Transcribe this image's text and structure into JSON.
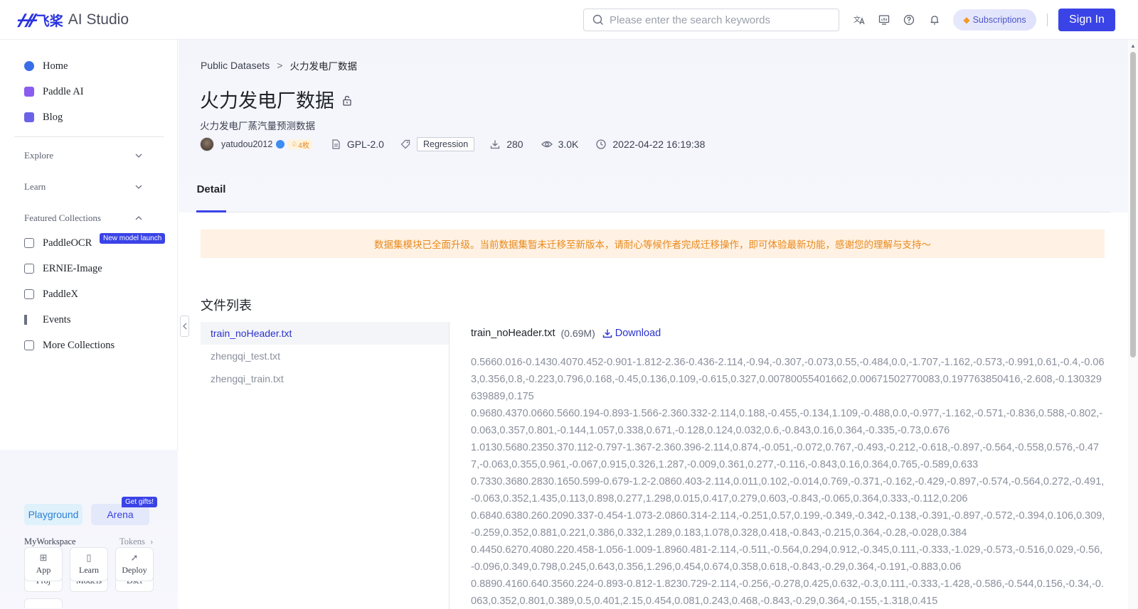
{
  "header": {
    "logo_mark": "ᚋᚌ",
    "logo_cn": "飞桨",
    "logo_text": "AI Studio",
    "search_placeholder": "Please enter the search keywords",
    "subscriptions_label": "Subscriptions",
    "signin_label": "Sign In",
    "icons": [
      "translate-icon",
      "monitor-icon",
      "help-icon",
      "bell-icon"
    ]
  },
  "sidebar": {
    "top_items": [
      {
        "label": "Home",
        "icon": "home-icon",
        "color": "#3a6ee8"
      },
      {
        "label": "Paddle AI",
        "icon": "paddle-ai-icon",
        "color": "#8a5cf0"
      },
      {
        "label": "Blog",
        "icon": "blog-icon",
        "color": "#6a63e8"
      }
    ],
    "sections": [
      {
        "label": "Explore",
        "chevron": "⌄"
      },
      {
        "label": "Learn",
        "chevron": "⌄"
      },
      {
        "label": "Featured Collections",
        "chevron": "⌃"
      }
    ],
    "collections": [
      {
        "label": "PaddleOCR",
        "icon": "ocr-icon"
      },
      {
        "label": "ERNIE-Image",
        "icon": "image-icon"
      },
      {
        "label": "PaddleX",
        "icon": "paddlex-icon"
      },
      {
        "label": "Events",
        "icon": "flag-icon"
      },
      {
        "label": "More Collections",
        "icon": "collections-icon"
      }
    ],
    "new_badge": "New model launch",
    "workspace": {
      "playground_label": "Playground",
      "arena_label": "Arena",
      "gift_badge": "Get gifts!",
      "title": "MyWorkspace",
      "tokens_label": "Tokens",
      "tiles": [
        {
          "label": "Proj",
          "icon": "folder-icon"
        },
        {
          "label": "Models",
          "icon": "cube-icon"
        },
        {
          "label": "Dset",
          "icon": "bar-chart-icon"
        },
        {
          "label": "App",
          "icon": "grid-icon"
        },
        {
          "label": "Learn",
          "icon": "book-icon"
        },
        {
          "label": "Deploy",
          "icon": "rocket-icon"
        }
      ]
    }
  },
  "dataset": {
    "breadcrumb_root": "Public Datasets",
    "breadcrumb_sep": ">",
    "breadcrumb_current": "火力发电厂数据",
    "title": "火力发电厂数据",
    "subtitle": "火力发电厂蒸汽量预测数据",
    "author": "yatudou2012",
    "author_level": "4枚",
    "license": "GPL-2.0",
    "tag": "Regression",
    "downloads": "280",
    "views": "3.0K",
    "date": "2022-04-22 16:19:38",
    "tab_detail": "Detail"
  },
  "notice": "数据集模块已全面升级。当前数据集暂未迁移至新版本，请耐心等候作者完成迁移操作，即可体验最新功能，感谢您的理解与支持～",
  "files": {
    "title": "文件列表",
    "items": [
      "train_noHeader.txt",
      "zhengqi_test.txt",
      "zhengqi_train.txt"
    ],
    "active_index": 0
  },
  "preview": {
    "filename": "train_noHeader.txt",
    "size": "(0.69M)",
    "download_label": "Download",
    "rows": [
      "0.5660.016-0.1430.4070.452-0.901-1.812-2.36-0.436-2.114,-0.94,-0.307,-0.073,0.55,-0.484,0.0,-1.707,-1.162,-0.573,-0.991,0.61,-0.4,-0.063,0.356,0.8,-0.223,0.796,0.168,-0.45,0.136,0.109,-0.615,0.327,0.00780055401662,0.00671502770083,0.197763850416,-2.608,-0.130329639889,0.175",
      "0.9680.4370.0660.5660.194-0.893-1.566-2.360.332-2.114,0.188,-0.455,-0.134,1.109,-0.488,0.0,-0.977,-1.162,-0.571,-0.836,0.588,-0.802,-0.063,0.357,0.801,-0.144,1.057,0.338,0.671,-0.128,0.124,0.032,0.6,-0.843,0.16,0.364,-0.335,-0.73,0.676",
      "1.0130.5680.2350.370.112-0.797-1.367-2.360.396-2.114,0.874,-0.051,-0.072,0.767,-0.493,-0.212,-0.618,-0.897,-0.564,-0.558,0.576,-0.477,-0.063,0.355,0.961,-0.067,0.915,0.326,1.287,-0.009,0.361,0.277,-0.116,-0.843,0.16,0.364,0.765,-0.589,0.633",
      "0.7330.3680.2830.1650.599-0.679-1.2-2.0860.403-2.114,0.011,0.102,-0.014,0.769,-0.371,-0.162,-0.429,-0.897,-0.574,-0.564,0.272,-0.491,-0.063,0.352,1.435,0.113,0.898,0.277,1.298,0.015,0.417,0.279,0.603,-0.843,-0.065,0.364,0.333,-0.112,0.206",
      "0.6840.6380.260.2090.337-0.454-1.073-2.0860.314-2.114,-0.251,0.57,0.199,-0.349,-0.342,-0.138,-0.391,-0.897,-0.572,-0.394,0.106,0.309,-0.259,0.352,0.881,0.221,0.386,0.332,1.289,0.183,1.078,0.328,0.418,-0.843,-0.215,0.364,-0.28,-0.028,0.384",
      "0.4450.6270.4080.220.458-1.056-1.009-1.8960.481-2.114,-0.511,-0.564,0.294,0.912,-0.345,0.111,-0.333,-1.029,-0.573,-0.516,0.029,-0.56,-0.096,0.349,0.798,0.245,0.643,0.356,1.296,0.454,0.674,0.358,0.618,-0.843,-0.29,0.364,-0.191,-0.883,0.06",
      "0.8890.4160.640.3560.224-0.893-0.812-1.8230.729-2.114,-0.256,-0.278,0.425,0.632,-0.3,0.111,-0.333,-1.428,-0.586,-0.544,0.156,-0.34,-0.063,0.352,0.801,0.389,0.5,0.401,2.15,0.454,0.081,0.243,0.468,-0.843,-0.29,0.364,-0.155,-1.318,0.415"
    ]
  },
  "colors": {
    "accent": "#3a43e6",
    "link": "#2a33cc",
    "notice_bg": "#fff1e3",
    "notice_text": "#e88a1d"
  }
}
